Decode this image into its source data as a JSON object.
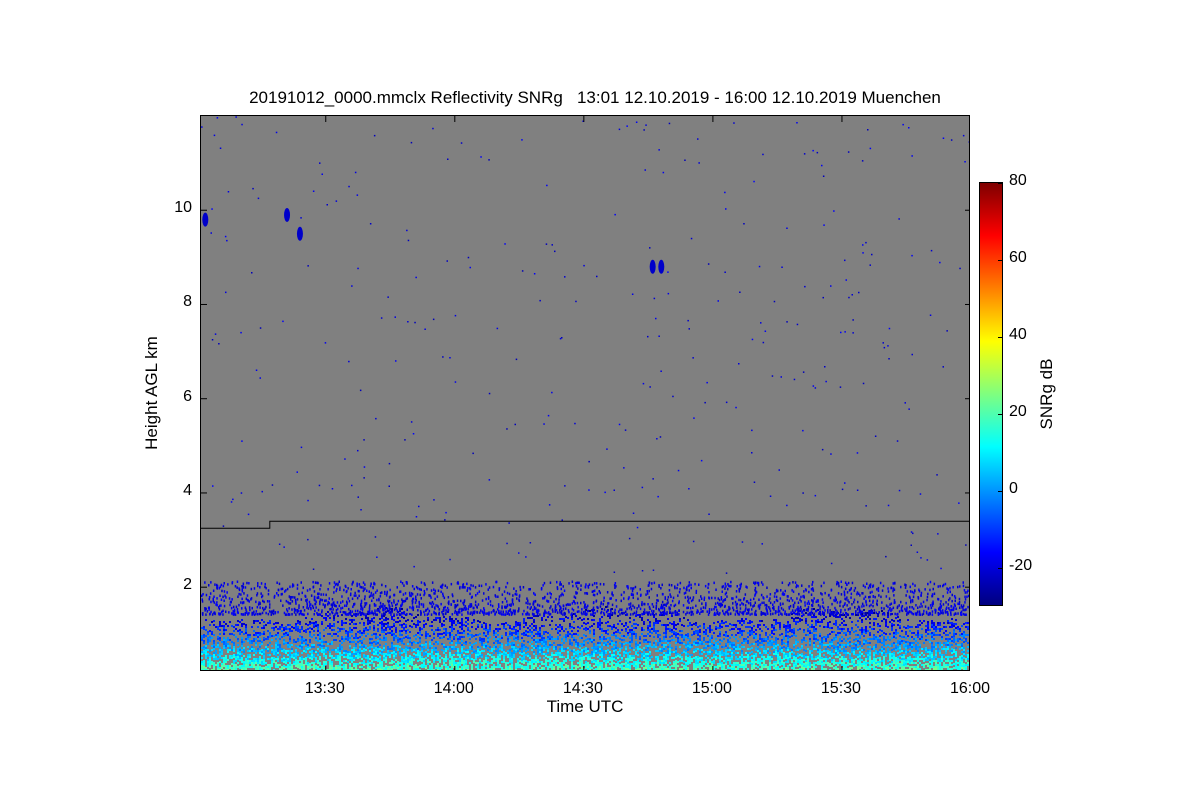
{
  "title": "20191012_0000.mmclx Reflectivity SNRg   13:01 12.10.2019 - 16:00 12.10.2019 Muenchen",
  "chart_data": {
    "type": "heatmap",
    "title": "20191012_0000.mmclx Reflectivity SNRg   13:01 12.10.2019 - 16:00 12.10.2019 Muenchen",
    "xlabel": "Time UTC",
    "ylabel": "Height AGL km",
    "xlim": [
      "13:01",
      "16:00"
    ],
    "ylim": [
      0.2,
      12.0
    ],
    "x_ticks": [
      "13:30",
      "14:00",
      "14:30",
      "15:00",
      "15:30",
      "16:00"
    ],
    "y_ticks": [
      "2",
      "4",
      "6",
      "8",
      "10"
    ],
    "background_color": "#808080",
    "colorbar": {
      "label": "SNRg dB",
      "range": [
        -30,
        80
      ],
      "ticks": [
        "-20",
        "0",
        "20",
        "40",
        "60",
        "80"
      ],
      "colormap": "jet"
    },
    "line_series": {
      "color": "#000000",
      "points": [
        [
          "13:01",
          3.25
        ],
        [
          "13:17",
          3.25
        ],
        [
          "13:17",
          3.4
        ],
        [
          "16:00",
          3.4
        ]
      ]
    },
    "echo_layer": {
      "dense_top_km": 1.4,
      "noise_top_km": 2.1,
      "near_surface_snr_db": [
        0,
        25
      ]
    },
    "features": [
      {
        "time": "13:02",
        "height_km": 9.8
      },
      {
        "time": "13:21",
        "height_km": 9.9
      },
      {
        "time": "13:24",
        "height_km": 9.5
      },
      {
        "time": "14:46",
        "height_km": 8.8
      },
      {
        "time": "14:48",
        "height_km": 8.8
      }
    ]
  }
}
